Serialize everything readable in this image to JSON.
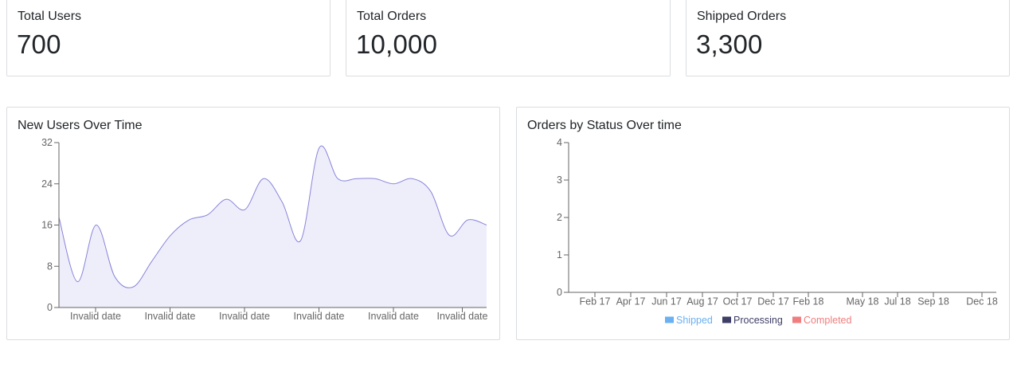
{
  "stats": [
    {
      "label": "Total Users",
      "value": "700"
    },
    {
      "label": "Total Orders",
      "value": "10,000"
    },
    {
      "label": "Shipped Orders",
      "value": "3,300"
    }
  ],
  "colors": {
    "area_fill": "#eeeefb",
    "area_line": "#8884d8",
    "shipped": "#6ab0f3",
    "processing": "#3e3e66",
    "completed": "#f07e7e",
    "axis": "#666666"
  },
  "chart_data": [
    {
      "type": "area",
      "title": "New Users Over Time",
      "xlabel": "",
      "ylabel": "",
      "ylim": [
        0,
        32
      ],
      "y_ticks": [
        0,
        8,
        16,
        24,
        32
      ],
      "x_tick_labels": [
        "Invalid date",
        "Invalid date",
        "Invalid date",
        "Invalid date",
        "Invalid date",
        "Invalid date"
      ],
      "values": [
        17.5,
        5,
        16,
        6,
        4,
        9,
        14,
        17,
        18,
        21,
        19,
        25,
        20.5,
        13,
        31,
        25,
        25,
        25,
        24,
        25,
        22.5,
        14,
        17,
        16
      ]
    },
    {
      "type": "line",
      "title": "Orders by Status Over time",
      "xlabel": "",
      "ylabel": "",
      "ylim": [
        0,
        4
      ],
      "y_ticks": [
        0,
        1,
        2,
        3,
        4
      ],
      "x_tick_labels": [
        "Feb 17",
        "Apr 17",
        "Jun 17",
        "Aug 17",
        "Oct 17",
        "Dec 17",
        "Feb 18",
        "May 18",
        "Jul 18",
        "Sep 18",
        "Dec 18"
      ],
      "series": [
        {
          "name": "Shipped",
          "values": []
        },
        {
          "name": "Processing",
          "values": []
        },
        {
          "name": "Completed",
          "values": []
        }
      ],
      "legend_position": "bottom"
    }
  ]
}
